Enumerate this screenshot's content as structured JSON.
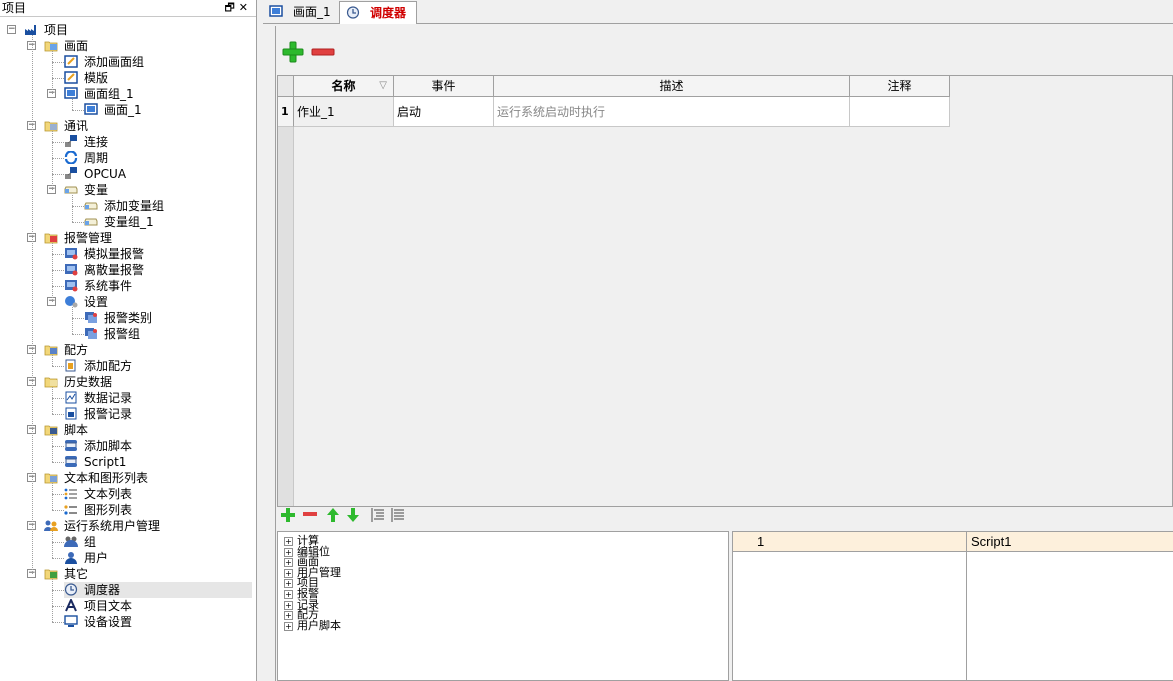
{
  "left_panel": {
    "title": "项目",
    "buttons": [
      "🗗",
      "✕"
    ]
  },
  "tree": [
    {
      "label": "项目",
      "icon": "factory-icon",
      "depth": 0,
      "expander": "−"
    },
    {
      "label": "画面",
      "icon": "screen-folder-icon",
      "depth": 1,
      "expander": "−"
    },
    {
      "label": "添加画面组",
      "icon": "add-screen-icon",
      "depth": 2
    },
    {
      "label": "模版",
      "icon": "template-icon",
      "depth": 2
    },
    {
      "label": "画面组_1",
      "icon": "screen-group-icon",
      "depth": 2,
      "expander": "−"
    },
    {
      "label": "画面_1",
      "icon": "screen-icon",
      "depth": 3
    },
    {
      "label": "通讯",
      "icon": "communication-folder-icon",
      "depth": 1,
      "expander": "−"
    },
    {
      "label": "连接",
      "icon": "connection-icon",
      "depth": 2
    },
    {
      "label": "周期",
      "icon": "cycle-icon",
      "depth": 2
    },
    {
      "label": "OPCUA",
      "icon": "opcua-icon",
      "depth": 2
    },
    {
      "label": "变量",
      "icon": "variable-icon",
      "depth": 2,
      "expander": "−"
    },
    {
      "label": "添加变量组",
      "icon": "add-variable-group-icon",
      "depth": 3
    },
    {
      "label": "变量组_1",
      "icon": "variable-group-icon",
      "depth": 3
    },
    {
      "label": "报警管理",
      "icon": "alarm-folder-icon",
      "depth": 1,
      "expander": "−"
    },
    {
      "label": "模拟量报警",
      "icon": "analog-alarm-icon",
      "depth": 2
    },
    {
      "label": "离散量报警",
      "icon": "discrete-alarm-icon",
      "depth": 2
    },
    {
      "label": "系统事件",
      "icon": "system-event-icon",
      "depth": 2
    },
    {
      "label": "设置",
      "icon": "settings-icon",
      "depth": 2,
      "expander": "−"
    },
    {
      "label": "报警类别",
      "icon": "alarm-class-icon",
      "depth": 3
    },
    {
      "label": "报警组",
      "icon": "alarm-group-icon",
      "depth": 3
    },
    {
      "label": "配方",
      "icon": "recipe-folder-icon",
      "depth": 1,
      "expander": "−"
    },
    {
      "label": "添加配方",
      "icon": "add-recipe-icon",
      "depth": 2
    },
    {
      "label": "历史数据",
      "icon": "history-folder-icon",
      "depth": 1,
      "expander": "−"
    },
    {
      "label": "数据记录",
      "icon": "data-log-icon",
      "depth": 2
    },
    {
      "label": "报警记录",
      "icon": "alarm-log-icon",
      "depth": 2
    },
    {
      "label": "脚本",
      "icon": "script-folder-icon",
      "depth": 1,
      "expander": "−"
    },
    {
      "label": "添加脚本",
      "icon": "add-script-icon",
      "depth": 2
    },
    {
      "label": "Script1",
      "icon": "script-icon",
      "depth": 2
    },
    {
      "label": "文本和图形列表",
      "icon": "text-graphic-folder-icon",
      "depth": 1,
      "expander": "−"
    },
    {
      "label": "文本列表",
      "icon": "text-list-icon",
      "depth": 2
    },
    {
      "label": "图形列表",
      "icon": "graphic-list-icon",
      "depth": 2
    },
    {
      "label": "运行系统用户管理",
      "icon": "user-management-icon",
      "depth": 1,
      "expander": "−"
    },
    {
      "label": "组",
      "icon": "user-group-icon",
      "depth": 2
    },
    {
      "label": "用户",
      "icon": "user-icon",
      "depth": 2
    },
    {
      "label": "其它",
      "icon": "other-folder-icon",
      "depth": 1,
      "expander": "−"
    },
    {
      "label": "调度器",
      "icon": "scheduler-icon",
      "depth": 2,
      "selected": true
    },
    {
      "label": "项目文本",
      "icon": "project-text-icon",
      "depth": 2
    },
    {
      "label": "设备设置",
      "icon": "device-settings-icon",
      "depth": 2
    }
  ],
  "tabs": [
    {
      "label": "画面_1",
      "icon": "screen-icon",
      "active": false
    },
    {
      "label": "调度器",
      "icon": "scheduler-icon",
      "active": true
    }
  ],
  "grid": {
    "columns": [
      "名称",
      "事件",
      "描述",
      "注释"
    ],
    "rows": [
      {
        "index": "1",
        "name": "作业_1",
        "event": "启动",
        "description": "运行系统启动时执行",
        "comment": ""
      }
    ]
  },
  "command_tree": [
    "计算",
    "编辑位",
    "画面",
    "用户管理",
    "项目",
    "报警",
    "记录",
    "配方",
    "用户脚本"
  ],
  "script_list": [
    {
      "index": "1",
      "name": "Script1"
    }
  ],
  "colors": {
    "add_green": "#2db92d",
    "remove_red": "#e04040",
    "active_tab_text": "#d00000",
    "selection_bg": "#e6e6e6"
  }
}
